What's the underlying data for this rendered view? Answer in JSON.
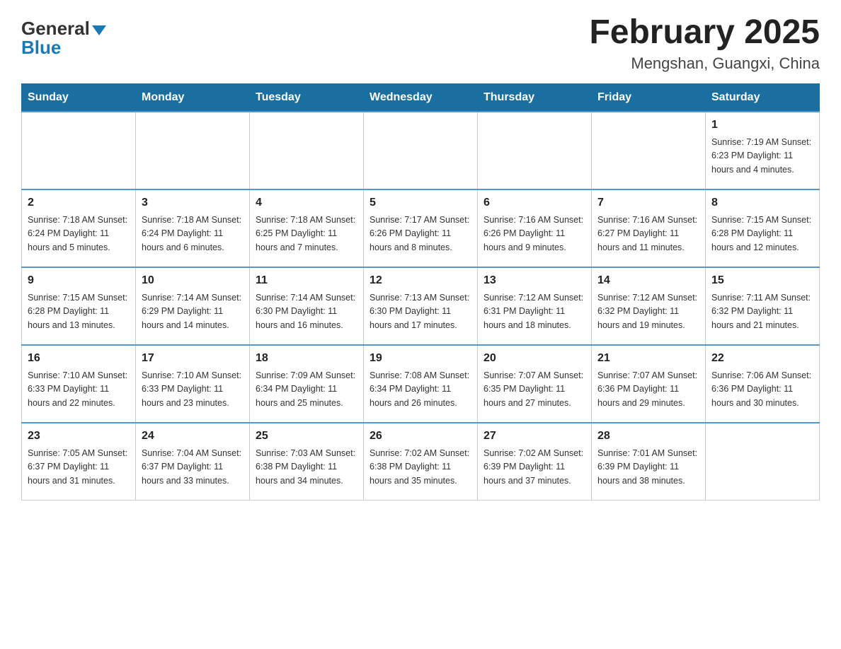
{
  "header": {
    "logo": {
      "general": "General",
      "blue": "Blue"
    },
    "title": "February 2025",
    "location": "Mengshan, Guangxi, China"
  },
  "weekdays": [
    "Sunday",
    "Monday",
    "Tuesday",
    "Wednesday",
    "Thursday",
    "Friday",
    "Saturday"
  ],
  "weeks": [
    [
      {
        "day": "",
        "info": ""
      },
      {
        "day": "",
        "info": ""
      },
      {
        "day": "",
        "info": ""
      },
      {
        "day": "",
        "info": ""
      },
      {
        "day": "",
        "info": ""
      },
      {
        "day": "",
        "info": ""
      },
      {
        "day": "1",
        "info": "Sunrise: 7:19 AM\nSunset: 6:23 PM\nDaylight: 11 hours and 4 minutes."
      }
    ],
    [
      {
        "day": "2",
        "info": "Sunrise: 7:18 AM\nSunset: 6:24 PM\nDaylight: 11 hours and 5 minutes."
      },
      {
        "day": "3",
        "info": "Sunrise: 7:18 AM\nSunset: 6:24 PM\nDaylight: 11 hours and 6 minutes."
      },
      {
        "day": "4",
        "info": "Sunrise: 7:18 AM\nSunset: 6:25 PM\nDaylight: 11 hours and 7 minutes."
      },
      {
        "day": "5",
        "info": "Sunrise: 7:17 AM\nSunset: 6:26 PM\nDaylight: 11 hours and 8 minutes."
      },
      {
        "day": "6",
        "info": "Sunrise: 7:16 AM\nSunset: 6:26 PM\nDaylight: 11 hours and 9 minutes."
      },
      {
        "day": "7",
        "info": "Sunrise: 7:16 AM\nSunset: 6:27 PM\nDaylight: 11 hours and 11 minutes."
      },
      {
        "day": "8",
        "info": "Sunrise: 7:15 AM\nSunset: 6:28 PM\nDaylight: 11 hours and 12 minutes."
      }
    ],
    [
      {
        "day": "9",
        "info": "Sunrise: 7:15 AM\nSunset: 6:28 PM\nDaylight: 11 hours and 13 minutes."
      },
      {
        "day": "10",
        "info": "Sunrise: 7:14 AM\nSunset: 6:29 PM\nDaylight: 11 hours and 14 minutes."
      },
      {
        "day": "11",
        "info": "Sunrise: 7:14 AM\nSunset: 6:30 PM\nDaylight: 11 hours and 16 minutes."
      },
      {
        "day": "12",
        "info": "Sunrise: 7:13 AM\nSunset: 6:30 PM\nDaylight: 11 hours and 17 minutes."
      },
      {
        "day": "13",
        "info": "Sunrise: 7:12 AM\nSunset: 6:31 PM\nDaylight: 11 hours and 18 minutes."
      },
      {
        "day": "14",
        "info": "Sunrise: 7:12 AM\nSunset: 6:32 PM\nDaylight: 11 hours and 19 minutes."
      },
      {
        "day": "15",
        "info": "Sunrise: 7:11 AM\nSunset: 6:32 PM\nDaylight: 11 hours and 21 minutes."
      }
    ],
    [
      {
        "day": "16",
        "info": "Sunrise: 7:10 AM\nSunset: 6:33 PM\nDaylight: 11 hours and 22 minutes."
      },
      {
        "day": "17",
        "info": "Sunrise: 7:10 AM\nSunset: 6:33 PM\nDaylight: 11 hours and 23 minutes."
      },
      {
        "day": "18",
        "info": "Sunrise: 7:09 AM\nSunset: 6:34 PM\nDaylight: 11 hours and 25 minutes."
      },
      {
        "day": "19",
        "info": "Sunrise: 7:08 AM\nSunset: 6:34 PM\nDaylight: 11 hours and 26 minutes."
      },
      {
        "day": "20",
        "info": "Sunrise: 7:07 AM\nSunset: 6:35 PM\nDaylight: 11 hours and 27 minutes."
      },
      {
        "day": "21",
        "info": "Sunrise: 7:07 AM\nSunset: 6:36 PM\nDaylight: 11 hours and 29 minutes."
      },
      {
        "day": "22",
        "info": "Sunrise: 7:06 AM\nSunset: 6:36 PM\nDaylight: 11 hours and 30 minutes."
      }
    ],
    [
      {
        "day": "23",
        "info": "Sunrise: 7:05 AM\nSunset: 6:37 PM\nDaylight: 11 hours and 31 minutes."
      },
      {
        "day": "24",
        "info": "Sunrise: 7:04 AM\nSunset: 6:37 PM\nDaylight: 11 hours and 33 minutes."
      },
      {
        "day": "25",
        "info": "Sunrise: 7:03 AM\nSunset: 6:38 PM\nDaylight: 11 hours and 34 minutes."
      },
      {
        "day": "26",
        "info": "Sunrise: 7:02 AM\nSunset: 6:38 PM\nDaylight: 11 hours and 35 minutes."
      },
      {
        "day": "27",
        "info": "Sunrise: 7:02 AM\nSunset: 6:39 PM\nDaylight: 11 hours and 37 minutes."
      },
      {
        "day": "28",
        "info": "Sunrise: 7:01 AM\nSunset: 6:39 PM\nDaylight: 11 hours and 38 minutes."
      },
      {
        "day": "",
        "info": ""
      }
    ]
  ]
}
